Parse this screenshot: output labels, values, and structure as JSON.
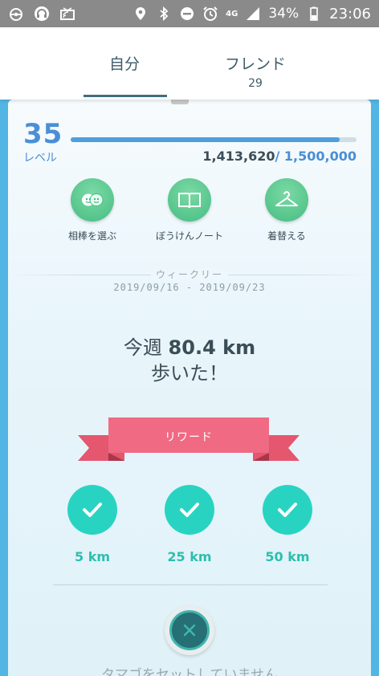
{
  "status_bar": {
    "network": "4G",
    "battery": "34%",
    "time": "23:06"
  },
  "tabs": {
    "self_label": "自分",
    "friends_label": "フレンド",
    "friends_count": "29"
  },
  "profile": {
    "level": "35",
    "level_label": "レベル",
    "xp_current": "1,413,620",
    "xp_max": "/ 1,500,000",
    "xp_progress_fraction": 0.9424
  },
  "actions": [
    {
      "label": "相棒を選ぶ",
      "icon": "buddy-icon"
    },
    {
      "label": "ぼうけんノート",
      "icon": "journal-book-icon"
    },
    {
      "label": "着替える",
      "icon": "hanger-icon"
    }
  ],
  "weekly": {
    "title": "ウィークリー",
    "dates": "2019/09/16 - 2019/09/23",
    "walked_prefix": "今週 ",
    "walked_distance": "80.4 km",
    "walked_suffix": "歩いた！"
  },
  "rewards": {
    "ribbon_label": "リワード",
    "milestones": [
      {
        "label": "5 km",
        "completed": true
      },
      {
        "label": "25 km",
        "completed": true
      },
      {
        "label": "50 km",
        "completed": true
      }
    ]
  },
  "egg": {
    "message": "タマゴをセットしていません"
  },
  "colors": {
    "accent_blue": "#4a8fd6",
    "frame_blue": "#52b5e4",
    "action_green": "#45bd82",
    "reward_teal": "#29d3c2",
    "ribbon_pink": "#f06a84"
  }
}
